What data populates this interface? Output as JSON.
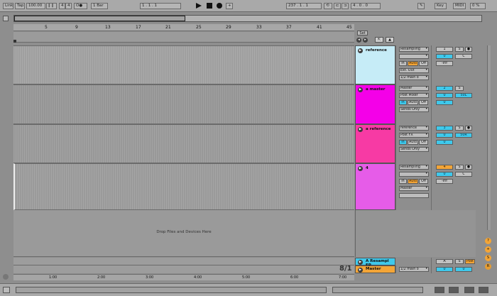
{
  "transport": {
    "link_label": "Link",
    "tap_label": "Tap",
    "tempo": "100.00",
    "signature_num": "4",
    "signature_den": "4",
    "metro_label": "O●",
    "quantize": "1 Bar",
    "position": "1 . 1 . 1",
    "loop_start": "237 . 1 . 1",
    "key_label": "Key",
    "midi_label": "MIDI",
    "bar_counter": "8/1"
  },
  "colors": {
    "reference": "#c6ecf7",
    "a_master": "#f400e8",
    "a_reference": "#f73aa4",
    "track_4": "#e65ce8",
    "return_a": "#3fc9ec",
    "master": "#f3a537"
  },
  "set_label": "Set",
  "drop_message": "Drop Files and Devices Here",
  "tracks": [
    {
      "name": "reference",
      "dot": "▶",
      "input": "Resampling",
      "channel": "",
      "monitor_in": "In",
      "monitor_auto": "Auto",
      "monitor_off": "Off",
      "output": "Ext. Out",
      "output_ch": "1/2 main o",
      "track_num": "1",
      "solo": "S",
      "vol": "0",
      "pan": "C",
      "send": "-inf"
    },
    {
      "name": "a master",
      "dot": "▶",
      "input": "Master",
      "channel": "Post Mixer",
      "monitor_in": "In",
      "monitor_auto": "Auto",
      "monitor_off": "Off",
      "output": "Sends Only",
      "track_num": "2",
      "solo": "S",
      "vol": "0",
      "pan": "50L",
      "send": "0"
    },
    {
      "name": "a reference",
      "dot": "▶",
      "input": "reference",
      "channel": "Post FX",
      "monitor_in": "In",
      "monitor_auto": "Auto",
      "monitor_off": "Off",
      "output": "Sends Only",
      "track_num": "3",
      "solo": "S",
      "vol": "0",
      "pan": "50R",
      "send": "0"
    },
    {
      "name": "4",
      "dot": "▶",
      "input": "Resampling",
      "channel": "",
      "monitor_in": "In",
      "monitor_auto": "Auto",
      "monitor_off": "Off",
      "output": "Master",
      "output_ch": "",
      "track_num": "4",
      "solo": "S",
      "vol": "0",
      "pan": "C",
      "send": "-inf"
    }
  ],
  "returns": [
    {
      "name": "A Resampl EP",
      "dot": "▶",
      "track_num": "A",
      "post": "Post",
      "vol": "0",
      "send": "0"
    }
  ],
  "master": {
    "name": "Master",
    "dot": "▶",
    "output": "1/2 main o",
    "vol": "0",
    "send": "0"
  },
  "ruler_marks": [
    "5",
    "9",
    "13",
    "17",
    "21",
    "25",
    "29",
    "33",
    "37",
    "41",
    "45"
  ],
  "bottom_ruler": [
    "1:00",
    "2:00",
    "3:00",
    "4:00",
    "5:00",
    "6:00",
    "7:00"
  ],
  "right_buttons": [
    "?",
    "+",
    "S",
    "R"
  ]
}
